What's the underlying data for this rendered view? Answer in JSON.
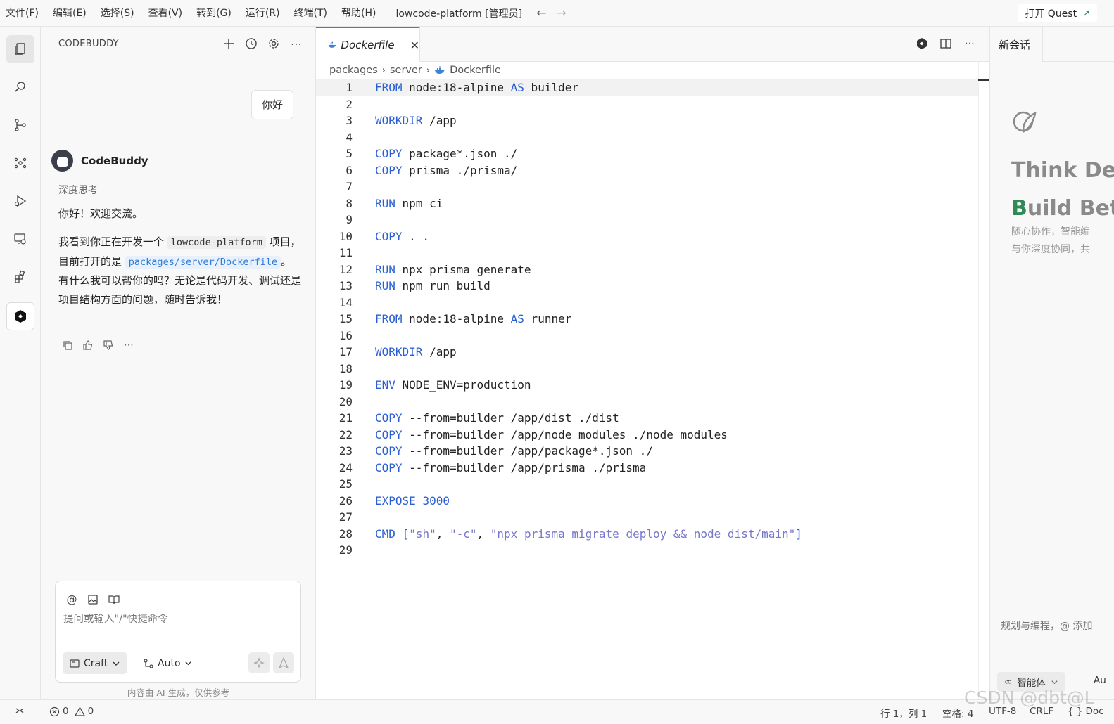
{
  "menu": {
    "items": [
      "文件(F)",
      "编辑(E)",
      "选择(S)",
      "查看(V)",
      "转到(G)",
      "运行(R)",
      "终端(T)",
      "帮助(H)"
    ],
    "window_title": "lowcode-platform [管理员]",
    "quest_button": "打开 Quest"
  },
  "sidebar": {
    "title": "CODEBUDDY",
    "user_message": "你好",
    "bot_name": "CodeBuddy",
    "thinking_label": "深度思考",
    "reply_line1": "你好！欢迎交流。",
    "reply_p1": "我看到你正在开发一个",
    "reply_code1": "lowcode-platform",
    "reply_p2": "项目，目前打开的是",
    "reply_code2": "packages/server/Dockerfile",
    "reply_p3": "。有什么我可以帮你的吗？无论是代码开发、调试还是项目结构方面的问题，随时告诉我！",
    "input_placeholder": "提问或输入\"/\"快捷命令",
    "mode_label": "Craft",
    "model_label": "Auto",
    "ai_note": "内容由 AI 生成，仅供参考"
  },
  "editor": {
    "tab_label": "Dockerfile",
    "breadcrumb": [
      "packages",
      "server",
      "Dockerfile"
    ],
    "lines": [
      [
        {
          "k": "FROM"
        },
        {
          "t": " node:18-alpine "
        },
        {
          "k": "AS"
        },
        {
          "t": " builder"
        }
      ],
      [],
      [
        {
          "k": "WORKDIR"
        },
        {
          "t": " /app"
        }
      ],
      [],
      [
        {
          "k": "COPY"
        },
        {
          "t": " package*.json ./"
        }
      ],
      [
        {
          "k": "COPY"
        },
        {
          "t": " prisma ./prisma/"
        }
      ],
      [],
      [
        {
          "k": "RUN"
        },
        {
          "t": " npm ci"
        }
      ],
      [],
      [
        {
          "k": "COPY"
        },
        {
          "t": " . ."
        }
      ],
      [],
      [
        {
          "k": "RUN"
        },
        {
          "t": " npx prisma generate"
        }
      ],
      [
        {
          "k": "RUN"
        },
        {
          "t": " npm run build"
        }
      ],
      [],
      [
        {
          "k": "FROM"
        },
        {
          "t": " node:18-alpine "
        },
        {
          "k": "AS"
        },
        {
          "t": " runner"
        }
      ],
      [],
      [
        {
          "k": "WORKDIR"
        },
        {
          "t": " /app"
        }
      ],
      [],
      [
        {
          "k": "ENV"
        },
        {
          "t": " NODE_ENV=production"
        }
      ],
      [],
      [
        {
          "k": "COPY"
        },
        {
          "t": " --from=builder /app/dist ./dist"
        }
      ],
      [
        {
          "k": "COPY"
        },
        {
          "t": " --from=builder /app/node_modules ./node_modules"
        }
      ],
      [
        {
          "k": "COPY"
        },
        {
          "t": " --from=builder /app/package*.json ./"
        }
      ],
      [
        {
          "k": "COPY"
        },
        {
          "t": " --from=builder /app/prisma ./prisma"
        }
      ],
      [],
      [
        {
          "k": "EXPOSE"
        },
        {
          "t": " "
        },
        {
          "k": "3000"
        }
      ],
      [],
      [
        {
          "k": "CMD"
        },
        {
          "t": " "
        },
        {
          "k": "["
        },
        {
          "s": "\"sh\""
        },
        {
          "t": ", "
        },
        {
          "s": "\"-c\""
        },
        {
          "t": ", "
        },
        {
          "s": "\"npx prisma migrate deploy && node dist/main\""
        },
        {
          "k": "]"
        }
      ],
      []
    ]
  },
  "right_panel": {
    "tab_label": "新会话",
    "headline1": "Think Dee",
    "headline2_first": "B",
    "headline2_rest": "uild Bet",
    "desc1": "随心协作，智能编",
    "desc2": "与你深度协同，共",
    "input_placeholder": "规划与编程，@ 添加",
    "agent_label": "智能体",
    "au_label": "Au"
  },
  "status": {
    "errors": "0",
    "warnings": "0",
    "position": "行 1，列 1",
    "spaces": "空格: 4",
    "encoding": "UTF-8",
    "eol": "CRLF",
    "language": "Doc"
  },
  "watermark": "CSDN @dbt@L",
  "colors": {
    "keyword": "#2a5fd4",
    "string": "#7777cc",
    "accent": "#3a7bd5",
    "quest_arrow": "#1a8f4f"
  }
}
